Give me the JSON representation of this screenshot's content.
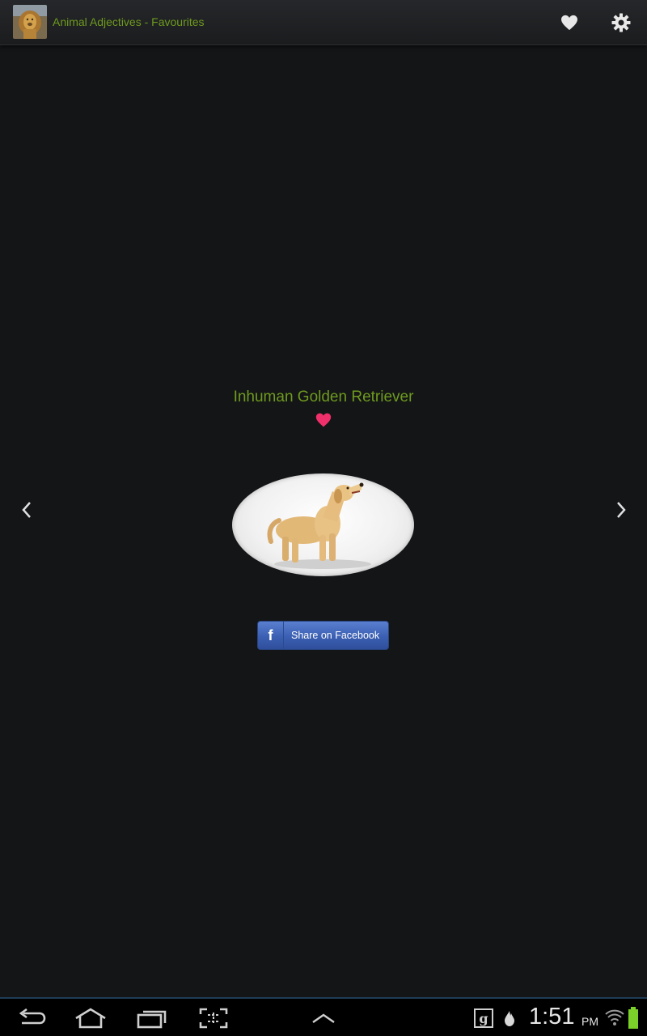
{
  "action_bar": {
    "title": "Animal Adjectives - Favourites",
    "app_icon": "lion-icon",
    "favourites_icon": "heart-icon",
    "settings_icon": "gear-icon"
  },
  "content": {
    "animal_name": "Inhuman Golden Retriever",
    "favourite_icon": "heart-icon",
    "favourite_color": "#f0306a",
    "image_subject": "golden retriever",
    "prev_icon": "chevron-left-icon",
    "next_icon": "chevron-right-icon",
    "share_button": {
      "label": "Share on Facebook",
      "icon": "facebook-icon"
    }
  },
  "system_bar": {
    "time": "1:51",
    "ampm": "PM",
    "accent": "#1f3c55"
  },
  "colors": {
    "title_green": "#6e9a1e",
    "background": "#141517",
    "facebook_blue": "#3b5fb2"
  }
}
